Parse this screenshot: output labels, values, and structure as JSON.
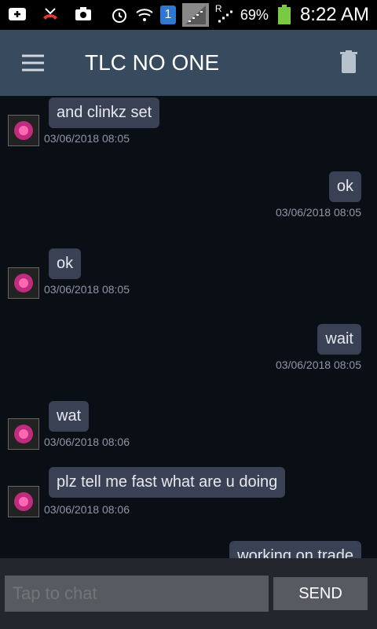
{
  "status": {
    "sim_badge": "1",
    "roaming": "R",
    "battery_percent": "69%",
    "time": "8:22 AM",
    "icons": [
      "add-icon",
      "missed-call-icon",
      "camera-icon",
      "alarm-icon",
      "wifi-icon",
      "sim-icon",
      "signal-icon",
      "signal-roaming-icon",
      "battery-icon"
    ]
  },
  "header": {
    "title": "TLC NO ONE",
    "menu_icon": "menu-icon",
    "delete_icon": "trash-icon"
  },
  "messages": [
    {
      "dir": "in",
      "text": "and clinkz set",
      "ts": "03/06/2018 08:05"
    },
    {
      "dir": "out",
      "text": "ok",
      "ts": "03/06/2018 08:05"
    },
    {
      "dir": "in",
      "text": "ok",
      "ts": "03/06/2018 08:05"
    },
    {
      "dir": "out",
      "text": "wait",
      "ts": "03/06/2018 08:05"
    },
    {
      "dir": "in",
      "text": "wat",
      "ts": "03/06/2018 08:06"
    },
    {
      "dir": "in",
      "text": "plz tell me fast what are u doing",
      "ts": "03/06/2018 08:06"
    },
    {
      "dir": "out",
      "text": "working on trade",
      "ts": ""
    }
  ],
  "composer": {
    "placeholder": "Tap to chat",
    "send_label": "SEND"
  },
  "colors": {
    "appbar": "#384a5e",
    "bubble": "#3a4154",
    "background": "#0a0f16",
    "battery": "#7ac943"
  }
}
